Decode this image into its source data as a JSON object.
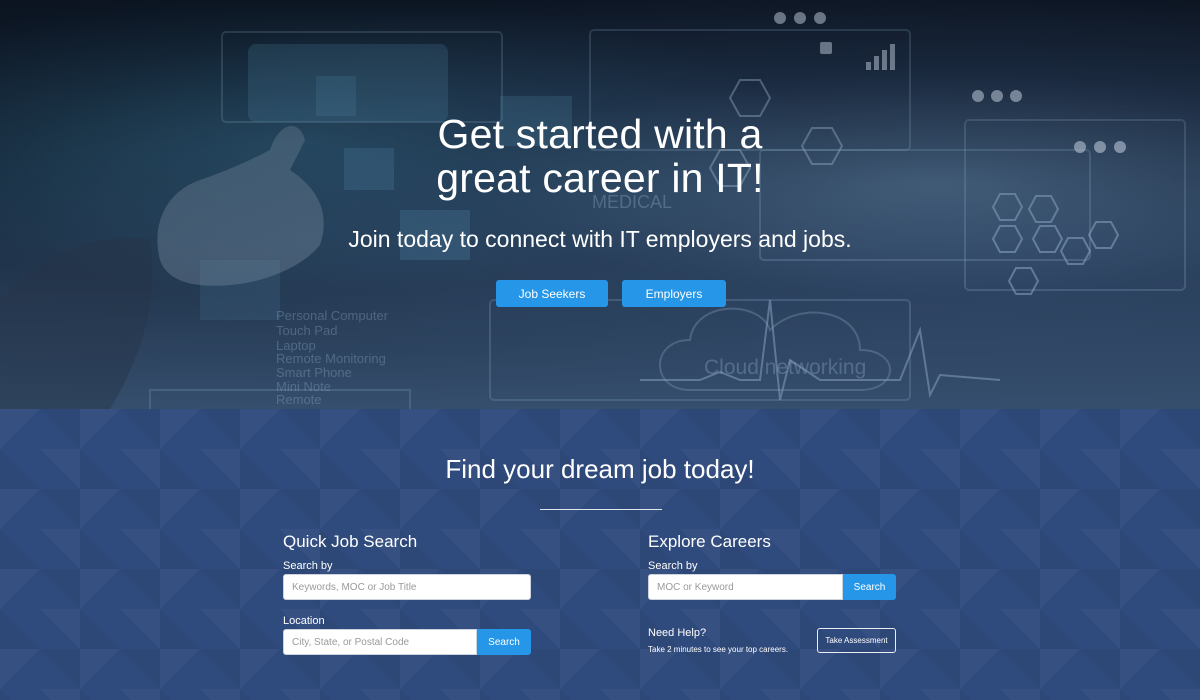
{
  "hero": {
    "title_line1": "Get started with a",
    "title_line2": "great career in IT!",
    "subtitle": "Join today to connect with IT employers and jobs.",
    "buttons": {
      "job_seekers": "Job Seekers",
      "employers": "Employers"
    },
    "background_text": {
      "cloud": "Cloud networking",
      "medical": "MEDICAL",
      "list": [
        "Personal Computer",
        "Touch Pad",
        "Laptop",
        "Remote Monitoring",
        "Smart Phone",
        "Mini Note",
        "Remote"
      ]
    }
  },
  "search_section": {
    "title": "Find your dream job today!",
    "quick_search": {
      "title": "Quick Job Search",
      "search_label": "Search by",
      "search_placeholder": "Keywords, MOC or Job Title",
      "location_label": "Location",
      "location_placeholder": "City, State, or Postal Code",
      "button": "Search"
    },
    "explore": {
      "title": "Explore Careers",
      "search_label": "Search by",
      "search_placeholder": "MOC or Keyword",
      "button": "Search",
      "help_title": "Need Help?",
      "help_text": "Take 2 minutes to see your top careers.",
      "assessment_button": "Take Assessment"
    }
  },
  "colors": {
    "primary_button": "#2596e8",
    "section_background": "#2f4a7c",
    "hero_dark": "#0d1522"
  }
}
